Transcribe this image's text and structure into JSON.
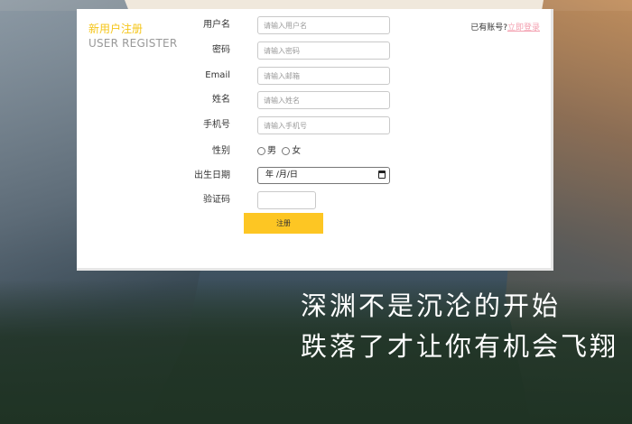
{
  "brand": {
    "title_cn": "新用户注册",
    "title_en": "USER REGISTER"
  },
  "login_hint": {
    "text": "已有账号?",
    "link": "立即登录"
  },
  "form": {
    "username": {
      "label": "用户名",
      "placeholder": "请输入用户名"
    },
    "password": {
      "label": "密码",
      "placeholder": "请输入密码"
    },
    "email": {
      "label": "Email",
      "placeholder": "请输入邮箱"
    },
    "name": {
      "label": "姓名",
      "placeholder": "请输入姓名"
    },
    "phone": {
      "label": "手机号",
      "placeholder": "请输入手机号"
    },
    "gender": {
      "label": "性别",
      "options": [
        "男",
        "女"
      ]
    },
    "birthdate": {
      "label": "出生日期",
      "value": "年 /月/日"
    },
    "captcha": {
      "label": "验证码"
    },
    "submit": "注册"
  },
  "slogan": {
    "line1": "深渊不是沉沦的开始",
    "line2": "跌落了才让你有机会飞翔"
  },
  "colors": {
    "accent": "#fdc623",
    "brand_text": "#f5c518",
    "link": "#f3a0b0"
  },
  "icons": [
    "calendar-icon",
    "radio-icon"
  ]
}
